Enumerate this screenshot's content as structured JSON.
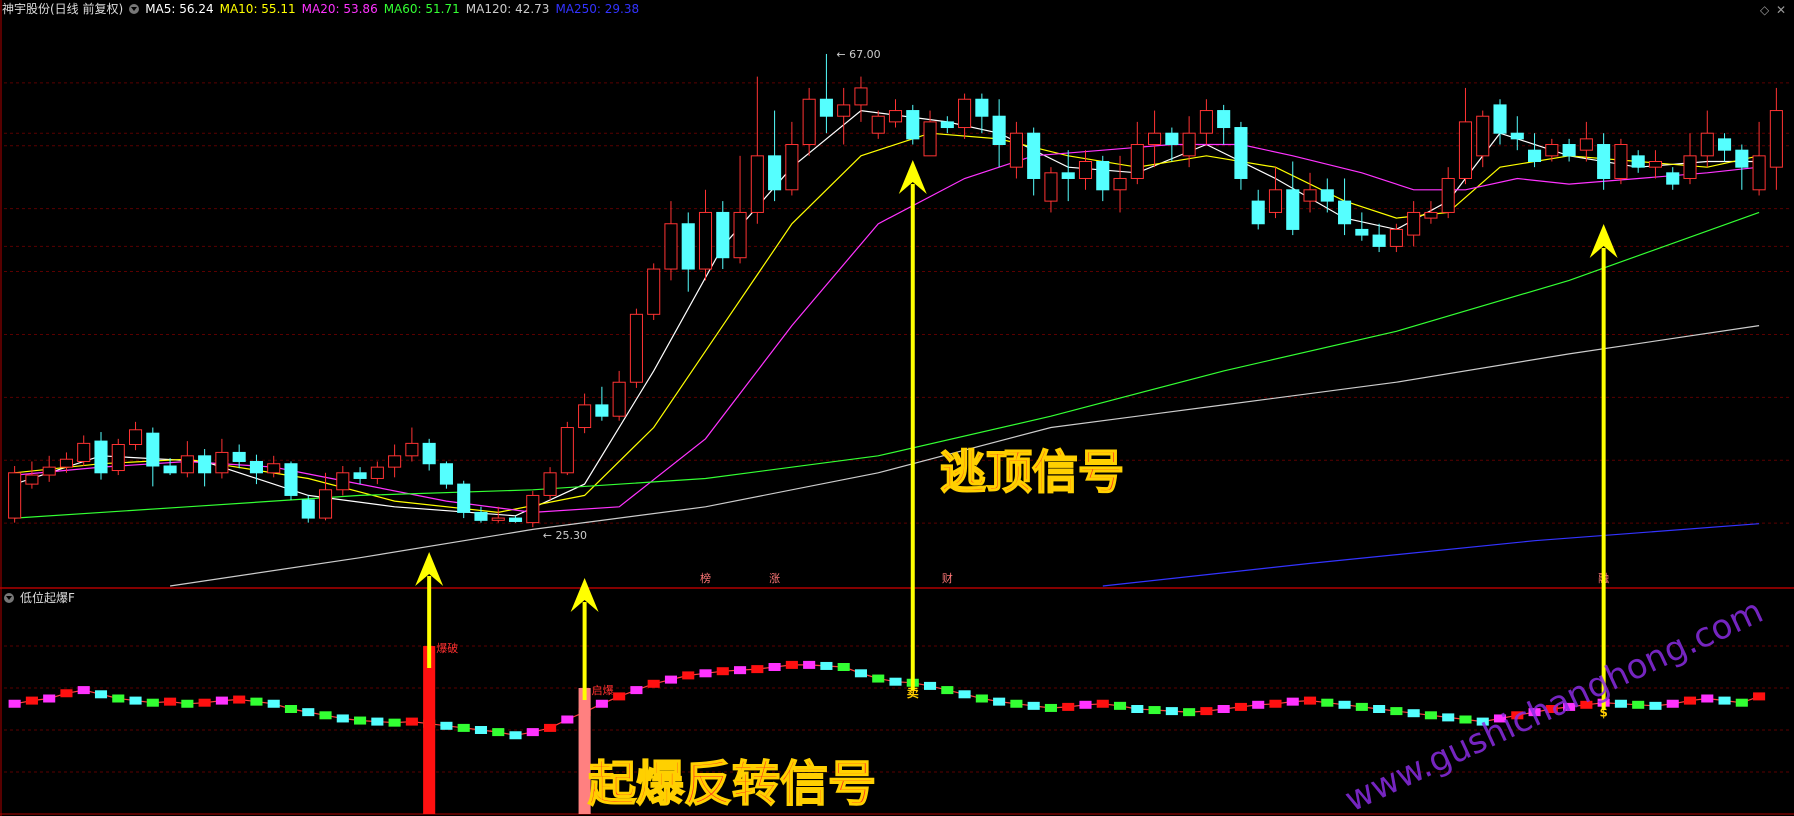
{
  "header": {
    "stock": "神宇股份(日线 前复权)",
    "ma": [
      {
        "label": "MA5: 56.24",
        "color": "#ffffff"
      },
      {
        "label": "MA10: 55.11",
        "color": "#ffff00"
      },
      {
        "label": "MA20: 53.86",
        "color": "#ff33ff"
      },
      {
        "label": "MA60: 51.71",
        "color": "#33ff33"
      },
      {
        "label": "MA120: 42.73",
        "color": "#cccccc"
      },
      {
        "label": "MA250: 29.38",
        "color": "#3333ff"
      }
    ]
  },
  "sub_header": {
    "indicator": "低位起爆F"
  },
  "icons": {
    "top_right": [
      "diamond-icon",
      "minus-icon",
      "close-icon"
    ]
  },
  "colors": {
    "up": "#ff3333",
    "down": "#55ffff",
    "grid": "#5a0000",
    "arrow": "#ffff00",
    "banner": "#ff2020",
    "watermark": "#8a2be2"
  },
  "chart_data": {
    "type": "candlestick",
    "price_ylim": [
      20,
      70
    ],
    "high_label": "67.00",
    "low_label": "25.30",
    "candles": [
      [
        26.0,
        30.0,
        25.6,
        30.6
      ],
      [
        29.0,
        29.8,
        28.6,
        31.0
      ],
      [
        29.8,
        30.5,
        29.2,
        31.5
      ],
      [
        30.5,
        31.2,
        30.0,
        31.8
      ],
      [
        31.0,
        32.6,
        30.6,
        33.3
      ],
      [
        32.8,
        30.0,
        29.4,
        33.6
      ],
      [
        30.2,
        32.5,
        29.8,
        33.0
      ],
      [
        32.5,
        33.8,
        32.0,
        34.5
      ],
      [
        33.5,
        30.6,
        28.8,
        34.0
      ],
      [
        30.6,
        30.0,
        29.8,
        31.3
      ],
      [
        30.0,
        31.5,
        29.6,
        32.8
      ],
      [
        31.5,
        30.0,
        28.8,
        32.1
      ],
      [
        30.0,
        31.8,
        29.5,
        33.0
      ],
      [
        31.8,
        31.0,
        30.4,
        32.5
      ],
      [
        31.0,
        30.0,
        29.0,
        31.6
      ],
      [
        30.0,
        30.8,
        29.6,
        31.5
      ],
      [
        30.8,
        28.0,
        27.6,
        31.0
      ],
      [
        27.6,
        26.0,
        25.6,
        28.0
      ],
      [
        26.0,
        28.5,
        25.8,
        30.0
      ],
      [
        28.5,
        30.0,
        28.0,
        30.6
      ],
      [
        30.0,
        29.5,
        29.0,
        30.5
      ],
      [
        29.5,
        30.5,
        29.0,
        31.0
      ],
      [
        30.5,
        31.5,
        29.6,
        32.5
      ],
      [
        31.5,
        32.6,
        31.0,
        34.0
      ],
      [
        32.6,
        30.8,
        30.2,
        33.0
      ],
      [
        30.8,
        29.0,
        28.6,
        31.0
      ],
      [
        29.0,
        26.5,
        26.0,
        29.3
      ],
      [
        26.5,
        25.8,
        25.6,
        27.0
      ],
      [
        25.8,
        26.0,
        25.6,
        27.0
      ],
      [
        26.0,
        25.7,
        25.6,
        26.2
      ],
      [
        25.6,
        28.0,
        25.2,
        28.4
      ],
      [
        28.0,
        30.0,
        27.6,
        30.5
      ],
      [
        30.0,
        34.0,
        29.8,
        34.5
      ],
      [
        34.0,
        36.0,
        33.5,
        37.0
      ],
      [
        36.0,
        35.0,
        34.6,
        37.6
      ],
      [
        35.0,
        38.0,
        34.6,
        39.0
      ],
      [
        38.0,
        44.0,
        37.5,
        44.5
      ],
      [
        44.0,
        48.0,
        43.5,
        48.5
      ],
      [
        48.0,
        52.0,
        47.0,
        54.0
      ],
      [
        52.0,
        48.0,
        46.0,
        53.0
      ],
      [
        48.0,
        53.0,
        47.0,
        55.0
      ],
      [
        53.0,
        49.0,
        48.0,
        54.0
      ],
      [
        49.0,
        53.0,
        48.5,
        58.0
      ],
      [
        53.0,
        58.0,
        52.0,
        65.0
      ],
      [
        58.0,
        55.0,
        54.0,
        62.0
      ],
      [
        55.0,
        59.0,
        54.5,
        61.0
      ],
      [
        59.0,
        63.0,
        58.0,
        64.0
      ],
      [
        63.0,
        61.5,
        60.0,
        67.0
      ],
      [
        61.5,
        62.5,
        59.0,
        64.0
      ],
      [
        62.5,
        64.0,
        61.0,
        65.0
      ],
      [
        60.0,
        61.5,
        59.5,
        62.0
      ],
      [
        61.0,
        62.0,
        60.5,
        63.0
      ],
      [
        62.0,
        59.5,
        59.0,
        62.5
      ],
      [
        58.0,
        61.0,
        58.5,
        62.0
      ],
      [
        61.0,
        60.5,
        60.0,
        61.5
      ],
      [
        60.5,
        63.0,
        59.5,
        63.5
      ],
      [
        63.0,
        61.5,
        60.0,
        63.5
      ],
      [
        61.5,
        59.0,
        57.0,
        63.0
      ],
      [
        57.0,
        60.0,
        56.0,
        61.0
      ],
      [
        60.0,
        56.0,
        54.5,
        60.5
      ],
      [
        54.0,
        56.5,
        53.0,
        57.0
      ],
      [
        56.5,
        56.0,
        54.0,
        58.5
      ],
      [
        56.0,
        57.5,
        55.0,
        58.5
      ],
      [
        57.5,
        55.0,
        54.0,
        58.0
      ],
      [
        55.0,
        56.0,
        53.0,
        58.0
      ],
      [
        56.0,
        59.0,
        55.5,
        61.0
      ],
      [
        59.0,
        60.0,
        57.0,
        62.0
      ],
      [
        60.0,
        59.0,
        57.5,
        60.5
      ],
      [
        58.0,
        60.0,
        57.0,
        61.5
      ],
      [
        60.0,
        62.0,
        59.0,
        63.0
      ],
      [
        62.0,
        60.5,
        59.0,
        62.5
      ],
      [
        60.5,
        56.0,
        55.0,
        61.0
      ],
      [
        54.0,
        52.0,
        51.5,
        55.0
      ],
      [
        53.0,
        55.0,
        52.5,
        57.0
      ],
      [
        55.0,
        51.5,
        51.0,
        57.5
      ],
      [
        54.0,
        55.0,
        53.0,
        56.5
      ],
      [
        55.0,
        54.0,
        53.0,
        56.0
      ],
      [
        54.0,
        52.0,
        51.0,
        56.0
      ],
      [
        51.5,
        51.0,
        50.5,
        53.0
      ],
      [
        51.0,
        50.0,
        49.5,
        52.0
      ],
      [
        50.0,
        51.5,
        49.5,
        52.0
      ],
      [
        51.0,
        53.0,
        50.0,
        54.0
      ],
      [
        52.5,
        53.0,
        52.0,
        54.0
      ],
      [
        53.0,
        56.0,
        52.5,
        57.0
      ],
      [
        56.0,
        61.0,
        55.5,
        64.0
      ],
      [
        58.0,
        61.5,
        57.0,
        62.0
      ],
      [
        62.5,
        60.0,
        59.0,
        63.0
      ],
      [
        60.0,
        59.5,
        58.5,
        61.5
      ],
      [
        58.5,
        57.5,
        57.0,
        60.0
      ],
      [
        58.0,
        59.0,
        57.5,
        59.5
      ],
      [
        59.0,
        58.0,
        57.5,
        59.5
      ],
      [
        58.5,
        59.5,
        57.5,
        61.0
      ],
      [
        59.0,
        56.0,
        55.0,
        60.0
      ],
      [
        56.0,
        59.0,
        55.5,
        59.5
      ],
      [
        58.0,
        57.0,
        56.5,
        58.5
      ],
      [
        57.0,
        57.5,
        56.0,
        58.5
      ],
      [
        56.5,
        55.5,
        55.0,
        57.0
      ],
      [
        56.0,
        58.0,
        55.5,
        60.0
      ],
      [
        58.0,
        60.0,
        57.0,
        62.0
      ],
      [
        59.5,
        58.5,
        57.5,
        60.0
      ],
      [
        58.5,
        57.0,
        55.0,
        59.0
      ],
      [
        55.0,
        58.0,
        54.5,
        61.0
      ],
      [
        57.0,
        62.0,
        55.0,
        64.0
      ]
    ],
    "ma_series": [
      {
        "name": "MA5",
        "points": [
          [
            0,
            29.0
          ],
          [
            5,
            31.5
          ],
          [
            11,
            31.0
          ],
          [
            17,
            28.0
          ],
          [
            22,
            27.0
          ],
          [
            29,
            26.2
          ],
          [
            33,
            29.0
          ],
          [
            37,
            39.0
          ],
          [
            41,
            50.0
          ],
          [
            45,
            57.0
          ],
          [
            49,
            62.0
          ],
          [
            54,
            61.0
          ],
          [
            57,
            60.0
          ],
          [
            61,
            57.0
          ],
          [
            65,
            56.5
          ],
          [
            69,
            59.0
          ],
          [
            73,
            56.0
          ],
          [
            77,
            52.5
          ],
          [
            80,
            51.5
          ],
          [
            83,
            54.0
          ],
          [
            86,
            60.0
          ],
          [
            90,
            58.0
          ],
          [
            94,
            57.0
          ],
          [
            98,
            57.5
          ],
          [
            101,
            57.5
          ]
        ]
      },
      {
        "name": "MA10",
        "points": [
          [
            0,
            30.0
          ],
          [
            5,
            30.8
          ],
          [
            10,
            31.2
          ],
          [
            17,
            29.5
          ],
          [
            22,
            27.5
          ],
          [
            28,
            26.5
          ],
          [
            33,
            28.0
          ],
          [
            37,
            34.0
          ],
          [
            41,
            43.0
          ],
          [
            45,
            52.0
          ],
          [
            49,
            58.0
          ],
          [
            53,
            60.0
          ],
          [
            57,
            59.5
          ],
          [
            61,
            58.0
          ],
          [
            65,
            57.0
          ],
          [
            69,
            58.0
          ],
          [
            73,
            57.0
          ],
          [
            77,
            54.0
          ],
          [
            80,
            52.5
          ],
          [
            83,
            53.0
          ],
          [
            86,
            57.0
          ],
          [
            90,
            58.0
          ],
          [
            94,
            57.5
          ],
          [
            98,
            57.0
          ],
          [
            101,
            58.0
          ]
        ]
      },
      {
        "name": "MA20",
        "points": [
          [
            0,
            29.8
          ],
          [
            5,
            30.5
          ],
          [
            10,
            31.0
          ],
          [
            15,
            30.5
          ],
          [
            20,
            29.0
          ],
          [
            25,
            27.5
          ],
          [
            30,
            26.5
          ],
          [
            35,
            27.0
          ],
          [
            40,
            33.0
          ],
          [
            45,
            43.0
          ],
          [
            50,
            52.0
          ],
          [
            55,
            56.0
          ],
          [
            59,
            58.0
          ],
          [
            63,
            58.5
          ],
          [
            67,
            59.0
          ],
          [
            71,
            59.0
          ],
          [
            74,
            58.0
          ],
          [
            78,
            56.5
          ],
          [
            81,
            55.0
          ],
          [
            84,
            55.0
          ],
          [
            87,
            56.0
          ],
          [
            90,
            55.5
          ],
          [
            94,
            56.0
          ],
          [
            98,
            56.5
          ],
          [
            101,
            57.0
          ]
        ]
      },
      {
        "name": "MA60",
        "points": [
          [
            0,
            26.0
          ],
          [
            10,
            27.0
          ],
          [
            20,
            28.0
          ],
          [
            30,
            28.5
          ],
          [
            40,
            29.5
          ],
          [
            50,
            31.5
          ],
          [
            60,
            35.0
          ],
          [
            70,
            39.0
          ],
          [
            80,
            42.5
          ],
          [
            90,
            47.0
          ],
          [
            101,
            53.0
          ]
        ]
      },
      {
        "name": "MA120",
        "points": [
          [
            9,
            20.0
          ],
          [
            20,
            22.5
          ],
          [
            30,
            25.0
          ],
          [
            40,
            27.0
          ],
          [
            50,
            30.0
          ],
          [
            60,
            34.0
          ],
          [
            70,
            36.0
          ],
          [
            80,
            38.0
          ],
          [
            90,
            40.5
          ],
          [
            101,
            43.0
          ]
        ]
      },
      {
        "name": "MA250",
        "points": [
          [
            63,
            20.0
          ],
          [
            75,
            22.0
          ],
          [
            88,
            24.0
          ],
          [
            101,
            25.5
          ]
        ]
      }
    ],
    "tags": [
      {
        "i": 40,
        "text": "榜"
      },
      {
        "i": 44,
        "text": "涨"
      },
      {
        "i": 54,
        "text": "财"
      },
      {
        "i": 92,
        "text": "融"
      }
    ],
    "indicator": {
      "ylim": [
        -100,
        100
      ],
      "values": [
        5,
        8,
        10,
        15,
        18,
        14,
        10,
        8,
        6,
        7,
        5,
        6,
        8,
        9,
        7,
        5,
        0,
        -3,
        -6,
        -9,
        -11,
        -12,
        -13,
        -12,
        -14,
        -16,
        -18,
        -20,
        -22,
        -25,
        -22,
        -18,
        -10,
        -3,
        5,
        12,
        18,
        24,
        28,
        32,
        34,
        36,
        37,
        38,
        40,
        42,
        42,
        41,
        40,
        34,
        29,
        26,
        25,
        22,
        18,
        14,
        10,
        7,
        5,
        3,
        1,
        2,
        4,
        5,
        3,
        0,
        -1,
        -2,
        -3,
        -2,
        0,
        2,
        4,
        5,
        7,
        8,
        6,
        4,
        2,
        0,
        -2,
        -4,
        -6,
        -8,
        -10,
        -12,
        -9,
        -6,
        -3,
        0,
        2,
        4,
        6,
        5,
        4,
        3,
        5,
        8,
        10,
        8,
        6,
        12
      ],
      "bars": [
        {
          "i": 24,
          "top": 60,
          "label": "爆破",
          "color": "#ff1010"
        },
        {
          "i": 33,
          "top": 20,
          "label": "启爆",
          "color": "#ff8080"
        }
      ],
      "signals": [
        {
          "i": 52,
          "text": "卖"
        },
        {
          "i": 92,
          "text": "$"
        }
      ]
    },
    "annotations": [
      {
        "text": "逃顶信号"
      },
      {
        "text": "起爆反转信号"
      }
    ],
    "watermark": "www.gushichanghong.com"
  }
}
